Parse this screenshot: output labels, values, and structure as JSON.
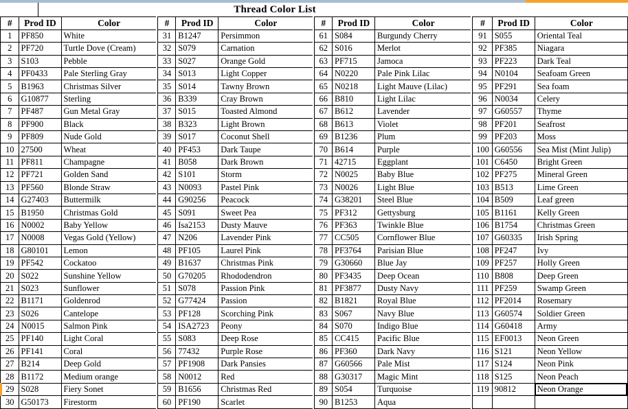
{
  "document": {
    "title": "Thread Color List"
  },
  "columns": {
    "num": "#",
    "prod_id": "Prod ID",
    "color": "Color"
  },
  "selection": {
    "active_cell_color": "Neon Orange",
    "active_row_number": "119",
    "marker_row_number": "29",
    "accent_color": "#f6a22a",
    "bar_color": "#a8bbd0"
  },
  "blocks": [
    {
      "rows": [
        {
          "num": "1",
          "pid": "PF850",
          "color": "White"
        },
        {
          "num": "2",
          "pid": "PF720",
          "color": "Turtle Dove (Cream)"
        },
        {
          "num": "3",
          "pid": "S103",
          "color": "Pebble"
        },
        {
          "num": "4",
          "pid": "PF0433",
          "color": "Pale Sterling Gray"
        },
        {
          "num": "5",
          "pid": "B1963",
          "color": "Christmas Silver"
        },
        {
          "num": "6",
          "pid": "G10877",
          "color": "Sterling"
        },
        {
          "num": "7",
          "pid": "PF487",
          "color": "Gun Metal Gray"
        },
        {
          "num": "8",
          "pid": "PF900",
          "color": "Black"
        },
        {
          "num": "9",
          "pid": "PF809",
          "color": "Nude Gold"
        },
        {
          "num": "10",
          "pid": "27500",
          "color": "Wheat"
        },
        {
          "num": "11",
          "pid": "PF811",
          "color": "Champagne"
        },
        {
          "num": "12",
          "pid": "PF721",
          "color": "Golden Sand"
        },
        {
          "num": "13",
          "pid": "PF560",
          "color": "Blonde Straw"
        },
        {
          "num": "14",
          "pid": "G27403",
          "color": "Buttermilk"
        },
        {
          "num": "15",
          "pid": "B1950",
          "color": "Christmas Gold"
        },
        {
          "num": "16",
          "pid": "N0002",
          "color": "Baby Yellow"
        },
        {
          "num": "17",
          "pid": "N0008",
          "color": "Vegas Gold (Yellow)"
        },
        {
          "num": "18",
          "pid": "G80101",
          "color": "Lemon"
        },
        {
          "num": "19",
          "pid": "PF542",
          "color": "Cockatoo"
        },
        {
          "num": "20",
          "pid": "S022",
          "color": "Sunshine Yellow"
        },
        {
          "num": "21",
          "pid": "S023",
          "color": "Sunflower"
        },
        {
          "num": "22",
          "pid": "B1171",
          "color": "Goldenrod"
        },
        {
          "num": "23",
          "pid": "S026",
          "color": "Cantelope"
        },
        {
          "num": "24",
          "pid": "N0015",
          "color": "Salmon Pink"
        },
        {
          "num": "25",
          "pid": "PF140",
          "color": "Light Coral"
        },
        {
          "num": "26",
          "pid": "PF141",
          "color": "Coral"
        },
        {
          "num": "27",
          "pid": "B214",
          "color": "Deep Gold"
        },
        {
          "num": "28",
          "pid": "B1172",
          "color": "Medium orange"
        },
        {
          "num": "29",
          "pid": "S028",
          "color": "Fiery Sonet"
        },
        {
          "num": "30",
          "pid": "G50173",
          "color": "Firestorm"
        }
      ]
    },
    {
      "rows": [
        {
          "num": "31",
          "pid": "B1247",
          "color": "Persimmon"
        },
        {
          "num": "32",
          "pid": "S079",
          "color": "Carnation"
        },
        {
          "num": "33",
          "pid": "S027",
          "color": "Orange Gold"
        },
        {
          "num": "34",
          "pid": "S013",
          "color": "Light Copper"
        },
        {
          "num": "35",
          "pid": "S014",
          "color": "Tawny Brown"
        },
        {
          "num": "36",
          "pid": "B339",
          "color": "Cray Brown"
        },
        {
          "num": "37",
          "pid": "S015",
          "color": "Toasted Almond"
        },
        {
          "num": "38",
          "pid": "B323",
          "color": "Light Brown"
        },
        {
          "num": "39",
          "pid": "S017",
          "color": "Coconut Shell"
        },
        {
          "num": "40",
          "pid": "PF453",
          "color": "Dark Taupe"
        },
        {
          "num": "41",
          "pid": "B058",
          "color": "Dark Brown"
        },
        {
          "num": "42",
          "pid": "S101",
          "color": "Storm"
        },
        {
          "num": "43",
          "pid": "N0093",
          "color": "Pastel Pink"
        },
        {
          "num": "44",
          "pid": "G90256",
          "color": "Peacock"
        },
        {
          "num": "45",
          "pid": "S091",
          "color": "Sweet Pea"
        },
        {
          "num": "46",
          "pid": "Isa2153",
          "color": "Dusty Mauve"
        },
        {
          "num": "47",
          "pid": "N206",
          "color": "Lavender Pink"
        },
        {
          "num": "48",
          "pid": "PF105",
          "color": "Laurel Pink"
        },
        {
          "num": "49",
          "pid": "B1637",
          "color": "Christmas Pink"
        },
        {
          "num": "50",
          "pid": "G70205",
          "color": "Rhododendron"
        },
        {
          "num": "51",
          "pid": "S078",
          "color": "Passion Pink"
        },
        {
          "num": "52",
          "pid": "G77424",
          "color": "Passion"
        },
        {
          "num": "53",
          "pid": "PF128",
          "color": "Scorching Pink"
        },
        {
          "num": "54",
          "pid": "ISA2723",
          "color": "Peony"
        },
        {
          "num": "55",
          "pid": "S083",
          "color": "Deep Rose"
        },
        {
          "num": "56",
          "pid": "77432",
          "color": "Purple Rose"
        },
        {
          "num": "57",
          "pid": "PF1908",
          "color": "Dark Pansies"
        },
        {
          "num": "58",
          "pid": "N0012",
          "color": "Red"
        },
        {
          "num": "59",
          "pid": "B1656",
          "color": "Christmas Red"
        },
        {
          "num": "60",
          "pid": "PF190",
          "color": "Scarlet"
        }
      ]
    },
    {
      "rows": [
        {
          "num": "61",
          "pid": "S084",
          "color": "Burgundy Cherry"
        },
        {
          "num": "62",
          "pid": "S016",
          "color": "Merlot"
        },
        {
          "num": "63",
          "pid": "PF715",
          "color": "Jamoca"
        },
        {
          "num": "64",
          "pid": "N0220",
          "color": "Pale Pink Lilac"
        },
        {
          "num": "65",
          "pid": "N0218",
          "color": "Light Mauve (Lilac)"
        },
        {
          "num": "66",
          "pid": "B810",
          "color": "Light  Lilac"
        },
        {
          "num": "67",
          "pid": "B612",
          "color": "Lavender"
        },
        {
          "num": "68",
          "pid": "B613",
          "color": "Violet"
        },
        {
          "num": "69",
          "pid": "B1236",
          "color": "Plum"
        },
        {
          "num": "70",
          "pid": "B614",
          "color": "Purple"
        },
        {
          "num": "71",
          "pid": "42715",
          "color": "Eggplant"
        },
        {
          "num": "72",
          "pid": "N0025",
          "color": "Baby Blue"
        },
        {
          "num": "73",
          "pid": "N0026",
          "color": "Light Blue"
        },
        {
          "num": "74",
          "pid": "G38201",
          "color": "Steel Blue"
        },
        {
          "num": "75",
          "pid": "PF312",
          "color": "Gettysburg"
        },
        {
          "num": "76",
          "pid": "PF363",
          "color": "Twinkle Blue"
        },
        {
          "num": "77",
          "pid": "CC505",
          "color": "Cornflower Blue"
        },
        {
          "num": "78",
          "pid": "PF3764",
          "color": "Parisian Blue"
        },
        {
          "num": "79",
          "pid": "G30660",
          "color": "Blue Jay"
        },
        {
          "num": "80",
          "pid": "PF3435",
          "color": "Deep Ocean"
        },
        {
          "num": "81",
          "pid": "PF3877",
          "color": "Dusty Navy"
        },
        {
          "num": "82",
          "pid": "B1821",
          "color": "Royal Blue"
        },
        {
          "num": "83",
          "pid": "S067",
          "color": "Navy Blue"
        },
        {
          "num": "84",
          "pid": "S070",
          "color": "Indigo Blue"
        },
        {
          "num": "85",
          "pid": "CC415",
          "color": "Pacific Blue"
        },
        {
          "num": "86",
          "pid": "PF360",
          "color": "Dark Navy"
        },
        {
          "num": "87",
          "pid": "G60566",
          "color": "Pale Mist"
        },
        {
          "num": "88",
          "pid": "G30317",
          "color": "Magic Mint"
        },
        {
          "num": "89",
          "pid": "S054",
          "color": "Turquoise"
        },
        {
          "num": "90",
          "pid": "B1253",
          "color": "Aqua"
        }
      ]
    },
    {
      "rows": [
        {
          "num": "91",
          "pid": "S055",
          "color": "Oriental Teal"
        },
        {
          "num": "92",
          "pid": "PF385",
          "color": "Niagara"
        },
        {
          "num": "93",
          "pid": "PF223",
          "color": "Dark Teal"
        },
        {
          "num": "94",
          "pid": "N0104",
          "color": "Seafoam Green"
        },
        {
          "num": "95",
          "pid": "PF291",
          "color": "Sea foam"
        },
        {
          "num": "96",
          "pid": "N0034",
          "color": "Celery"
        },
        {
          "num": "97",
          "pid": "G60557",
          "color": "Thyme"
        },
        {
          "num": "98",
          "pid": "PF201",
          "color": "Seafrost"
        },
        {
          "num": "99",
          "pid": "PF203",
          "color": "Moss"
        },
        {
          "num": "100",
          "pid": "G60556",
          "color": "Sea Mist (Mint Julip)"
        },
        {
          "num": "101",
          "pid": "C6450",
          "color": "Bright Green"
        },
        {
          "num": "102",
          "pid": "PF275",
          "color": "Mineral Green"
        },
        {
          "num": "103",
          "pid": "B513",
          "color": "Lime Green"
        },
        {
          "num": "104",
          "pid": "B509",
          "color": "Leaf green"
        },
        {
          "num": "105",
          "pid": "B1161",
          "color": "Kelly Green"
        },
        {
          "num": "106",
          "pid": "B1754",
          "color": "Christmas Green"
        },
        {
          "num": "107",
          "pid": "G60335",
          "color": "Irish Spring"
        },
        {
          "num": "108",
          "pid": "PF247",
          "color": "Ivy"
        },
        {
          "num": "109",
          "pid": "PF257",
          "color": "Holly Green"
        },
        {
          "num": "110",
          "pid": "B808",
          "color": "Deep Green"
        },
        {
          "num": "111",
          "pid": "PF259",
          "color": "Swamp Green"
        },
        {
          "num": "112",
          "pid": "PF2014",
          "color": "Rosemary"
        },
        {
          "num": "113",
          "pid": "G60574",
          "color": "Soldier Green"
        },
        {
          "num": "114",
          "pid": "G60418",
          "color": "Army"
        },
        {
          "num": "115",
          "pid": "EF0013",
          "color": "Neon Green"
        },
        {
          "num": "116",
          "pid": "S121",
          "color": "Neon Yellow"
        },
        {
          "num": "117",
          "pid": "S124",
          "color": "Neon Pink"
        },
        {
          "num": "118",
          "pid": "S125",
          "color": "Neon Peach"
        },
        {
          "num": "119",
          "pid": "90812",
          "color": "Neon Orange"
        }
      ]
    }
  ]
}
